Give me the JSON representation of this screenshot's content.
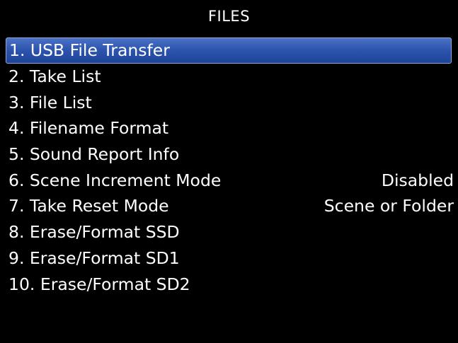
{
  "screen": {
    "title": "FILES",
    "selected_index": 0
  },
  "colors": {
    "background": "#000000",
    "text": "#ffffff",
    "highlight": "#2c53ad"
  },
  "menu": {
    "items": [
      {
        "label": "1. USB File Transfer",
        "value": ""
      },
      {
        "label": "2. Take List",
        "value": ""
      },
      {
        "label": "3. File List",
        "value": ""
      },
      {
        "label": "4. Filename Format",
        "value": ""
      },
      {
        "label": "5. Sound Report Info",
        "value": ""
      },
      {
        "label": "6. Scene Increment Mode",
        "value": "Disabled"
      },
      {
        "label": "7. Take Reset Mode",
        "value": "Scene or Folder"
      },
      {
        "label": "8. Erase/Format SSD",
        "value": ""
      },
      {
        "label": "9. Erase/Format SD1",
        "value": ""
      },
      {
        "label": "10. Erase/Format SD2",
        "value": ""
      }
    ]
  }
}
